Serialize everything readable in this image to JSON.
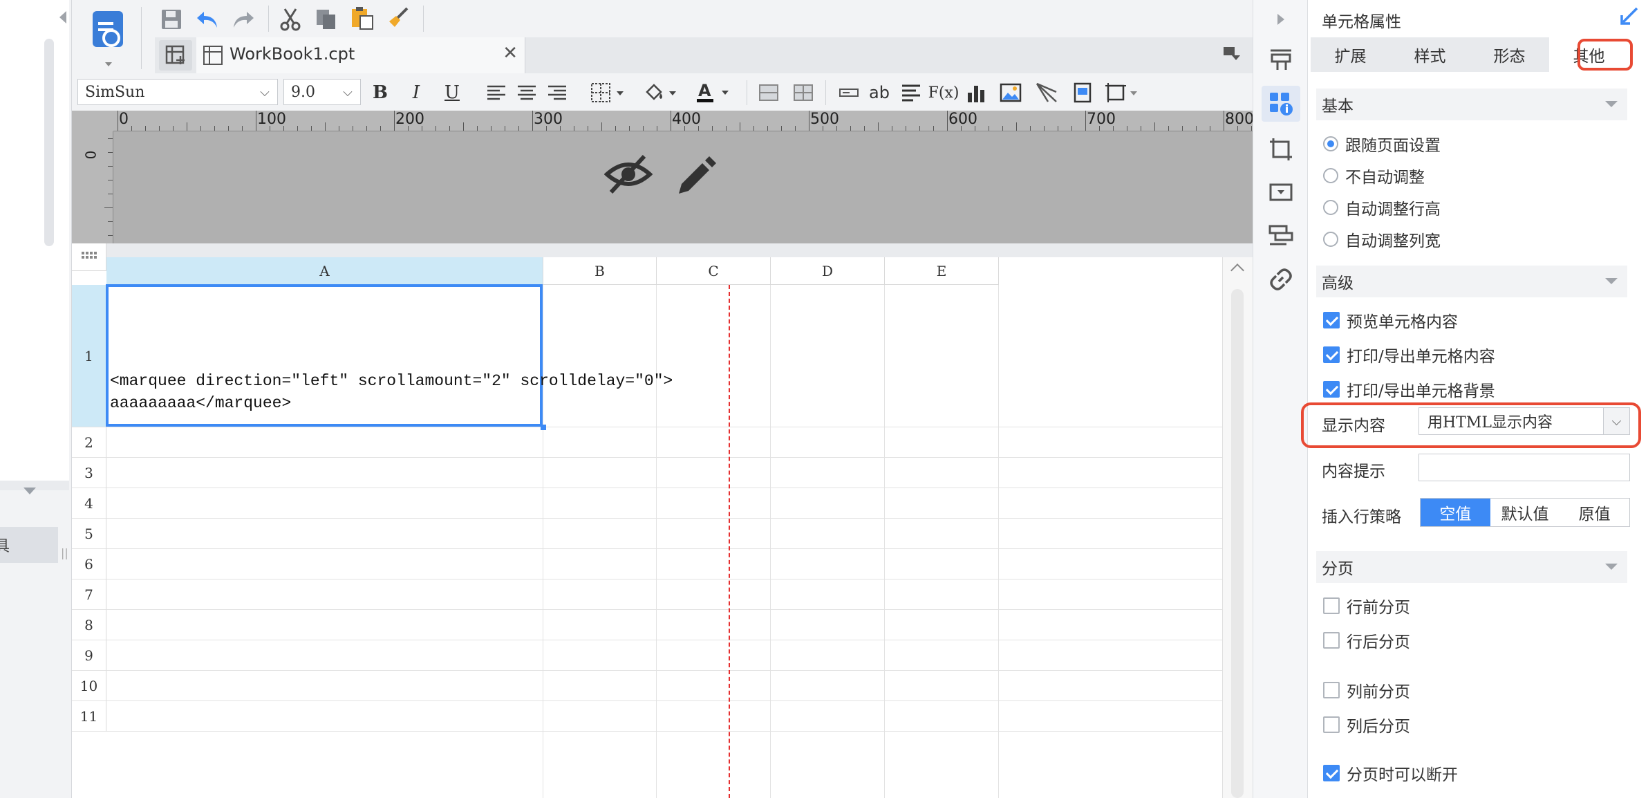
{
  "left_panel": {
    "item_label": "具"
  },
  "toolbar": {
    "save": "save-icon",
    "undo": "undo-icon",
    "redo": "redo-icon",
    "cut": "cut-icon",
    "copy": "copy-icon",
    "paste": "paste-icon",
    "format_painter": "format-painter-icon"
  },
  "tab": {
    "name": "WorkBook1.cpt",
    "close": "✕"
  },
  "format": {
    "font_family": "SimSun",
    "font_size": "9.0",
    "bold": "B",
    "italic": "I",
    "underline": "U",
    "text_ab": "ab",
    "formula": "F(x)"
  },
  "ruler": {
    "labels": [
      "0",
      "100",
      "200",
      "300",
      "400",
      "500",
      "600",
      "700",
      "800"
    ],
    "vertical_zero": "0"
  },
  "sheet": {
    "columns": [
      "A",
      "B",
      "C",
      "D",
      "E"
    ],
    "rows": [
      "1",
      "2",
      "3",
      "4",
      "5",
      "6",
      "7",
      "8",
      "9",
      "10",
      "11"
    ],
    "cell_a1_line1": "<marquee direction=\"left\" scrollamount=\"2\" scrolldelay=\"0\">",
    "cell_a1_line2": "aaaaaaaaa</marquee>"
  },
  "panel": {
    "title": "单元格属性",
    "tabs": [
      "扩展",
      "样式",
      "形态",
      "其他"
    ],
    "active_tab": "其他",
    "basic": {
      "header": "基本",
      "options": [
        "跟随页面设置",
        "不自动调整",
        "自动调整行高",
        "自动调整列宽"
      ],
      "selected": "跟随页面设置"
    },
    "advanced": {
      "header": "高级",
      "checks": [
        {
          "label": "预览单元格内容",
          "checked": true
        },
        {
          "label": "打印/导出单元格内容",
          "checked": true
        },
        {
          "label": "打印/导出单元格背景",
          "checked": true
        }
      ],
      "display_label": "显示内容",
      "display_value": "用HTML显示内容",
      "hint_label": "内容提示",
      "hint_value": "",
      "insert_label": "插入行策略",
      "insert_options": [
        "空值",
        "默认值",
        "原值"
      ],
      "insert_selected": "空值"
    },
    "paging": {
      "header": "分页",
      "checks": [
        {
          "label": "行前分页",
          "checked": false
        },
        {
          "label": "行后分页",
          "checked": false
        },
        {
          "label": "列前分页",
          "checked": false
        },
        {
          "label": "列后分页",
          "checked": false
        },
        {
          "label": "分页时可以断开",
          "checked": true
        }
      ]
    }
  },
  "colors": {
    "accent": "#3d8af5",
    "highlight": "#e84a34",
    "page_break": "#e53030",
    "selected_header": "#cde9f7"
  }
}
